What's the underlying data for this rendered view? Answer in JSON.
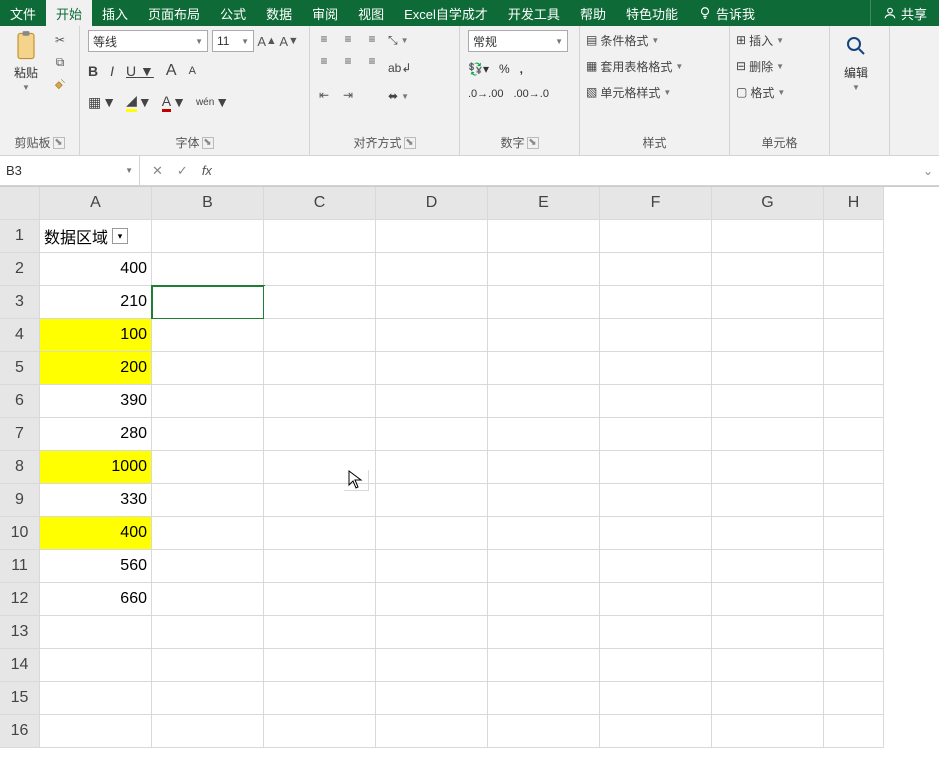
{
  "menu": {
    "file": "文件",
    "home": "开始",
    "insert": "插入",
    "layout": "页面布局",
    "formula": "公式",
    "data": "数据",
    "review": "审阅",
    "view": "视图",
    "excel_self": "Excel自学成才",
    "dev": "开发工具",
    "help": "帮助",
    "special": "特色功能",
    "tell": "告诉我",
    "share": "共享"
  },
  "ribbon": {
    "clipboard": {
      "paste": "粘贴",
      "label": "剪贴板"
    },
    "font": {
      "name": "等线",
      "size": "11",
      "bold": "B",
      "italic": "I",
      "underline": "U",
      "bigA": "A",
      "smallA": "A",
      "wen": "wén",
      "label": "字体"
    },
    "align": {
      "wrap": "自动换行",
      "merge": "合并后居中",
      "label": "对齐方式"
    },
    "number": {
      "format": "常规",
      "label": "数字"
    },
    "styles": {
      "cond": "条件格式",
      "table": "套用表格格式",
      "cell": "单元格样式",
      "label": "样式"
    },
    "cells": {
      "insert": "插入",
      "delete": "删除",
      "format": "格式",
      "label": "单元格"
    },
    "editing": {
      "label": "编辑"
    }
  },
  "formula_bar": {
    "name_box": "B3",
    "fx": "fx",
    "clear": "✕",
    "accept": "✓"
  },
  "sheet": {
    "cols": [
      "A",
      "B",
      "C",
      "D",
      "E",
      "F",
      "G",
      "H"
    ],
    "rows": [
      "1",
      "2",
      "3",
      "4",
      "5",
      "6",
      "7",
      "8",
      "9",
      "10",
      "11",
      "12",
      "13",
      "14",
      "15",
      "16"
    ],
    "a1": "数据区域",
    "data": [
      {
        "v": "400",
        "hl": false
      },
      {
        "v": "210",
        "hl": false
      },
      {
        "v": "100",
        "hl": true
      },
      {
        "v": "200",
        "hl": true
      },
      {
        "v": "390",
        "hl": false
      },
      {
        "v": "280",
        "hl": false
      },
      {
        "v": "1000",
        "hl": true
      },
      {
        "v": "330",
        "hl": false
      },
      {
        "v": "400",
        "hl": true
      },
      {
        "v": "560",
        "hl": false
      },
      {
        "v": "660",
        "hl": false
      }
    ],
    "selected": "B3"
  }
}
